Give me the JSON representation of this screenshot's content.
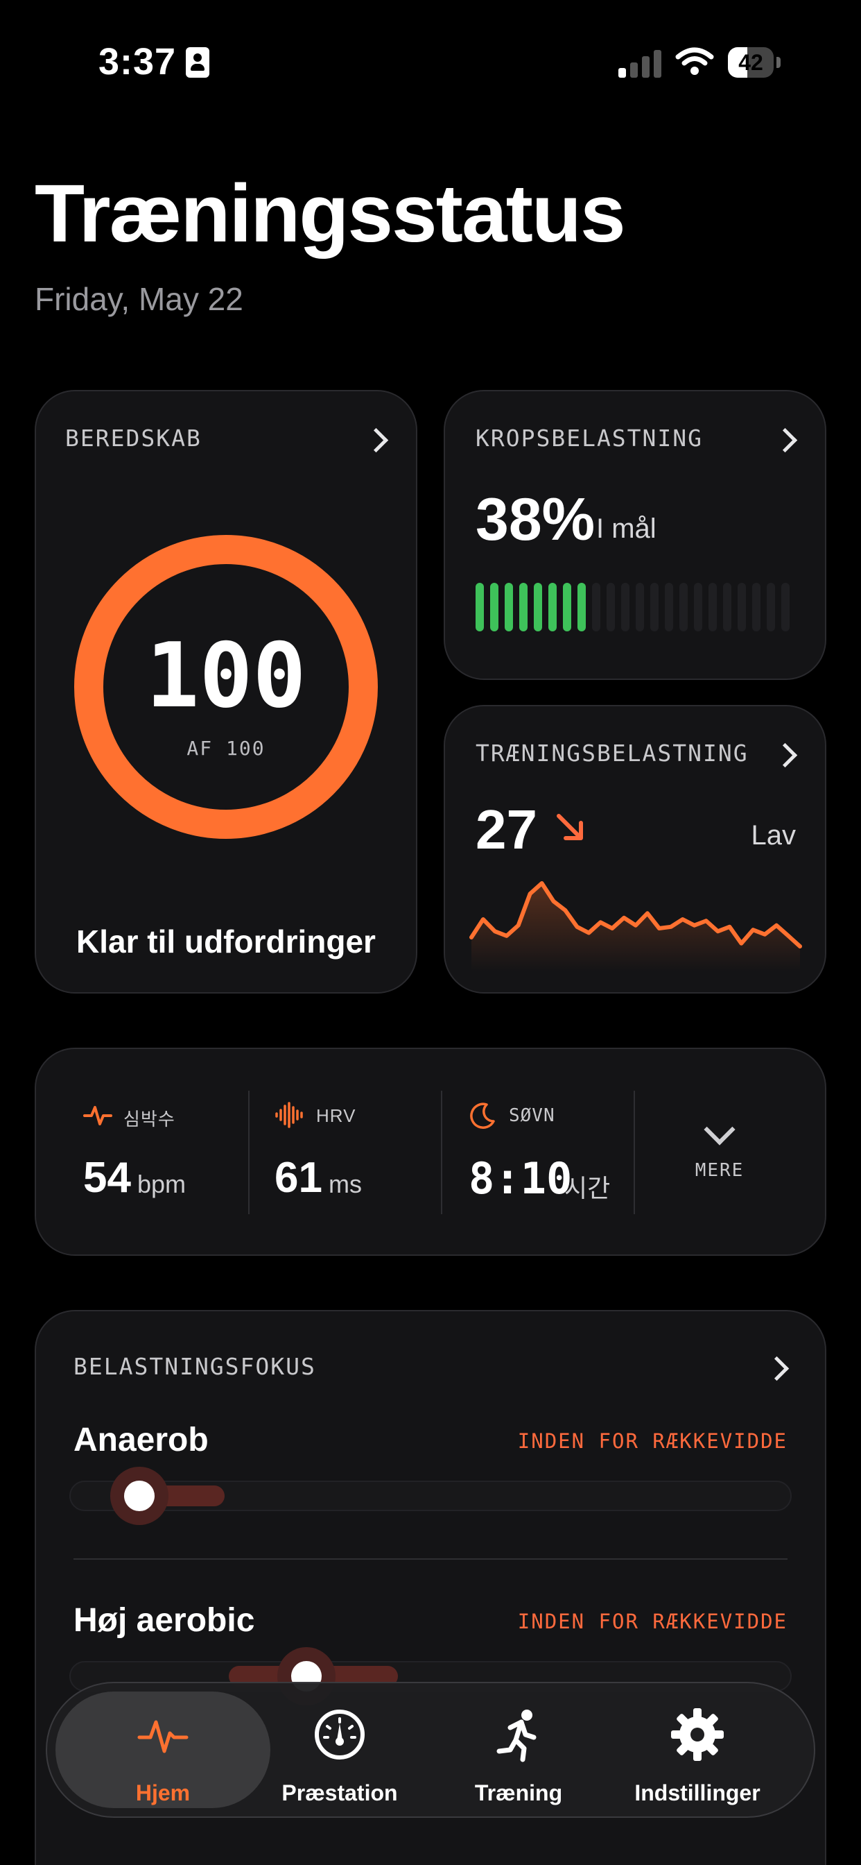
{
  "status_bar": {
    "time": "3:37",
    "battery": "42",
    "battery_level": 0.42
  },
  "header": {
    "title": "Træningsstatus",
    "date": "Friday, May 22"
  },
  "readiness": {
    "label": "BEREDSKAB",
    "value": "100",
    "max_label": "AF 100",
    "value_num": 100,
    "max_num": 100,
    "status": "Klar til udfordringer",
    "color": "#ff7130"
  },
  "body_load": {
    "label": "KROPSBELASTNING",
    "percent": "38%",
    "status": "I mål",
    "filled_bars": 8,
    "total_bars": 22,
    "fill_color": "#3ec25a"
  },
  "training_load": {
    "label": "TRÆNINGSBELASTNING",
    "value": "27",
    "trend": "down",
    "status": "Lav",
    "color": "#ff7130",
    "series": [
      18,
      30,
      22,
      19,
      26,
      47,
      54,
      42,
      36,
      25,
      21,
      28,
      24,
      31,
      26,
      34,
      24,
      25,
      30,
      26,
      29,
      22,
      25,
      14,
      23,
      20,
      26,
      19,
      12
    ]
  },
  "stats": {
    "heart_rate": {
      "label": "심박수",
      "value": "54",
      "unit": "bpm",
      "icon": "heart-pulse-icon"
    },
    "hrv": {
      "label": "HRV",
      "value": "61",
      "unit": "ms",
      "icon": "waveform-icon"
    },
    "sleep": {
      "label": "SØVN",
      "value": "8:10",
      "unit": "시간",
      "icon": "moon-icon"
    },
    "more_label": "MERE"
  },
  "load_focus": {
    "label": "BELASTNINGSFOKUS",
    "items": [
      {
        "name": "Anaerob",
        "state": "INDEN FOR RÆKKEVIDDE"
      },
      {
        "name": "Høj aerobic",
        "state": "INDEN FOR RÆKKEVIDDE"
      }
    ]
  },
  "tabs": [
    {
      "label": "Hjem",
      "icon": "heartbeat-icon",
      "active": true
    },
    {
      "label": "Præstation",
      "icon": "gauge-icon",
      "active": false
    },
    {
      "label": "Træning",
      "icon": "running-icon",
      "active": false
    },
    {
      "label": "Indstillinger",
      "icon": "gear-icon",
      "active": false
    }
  ]
}
